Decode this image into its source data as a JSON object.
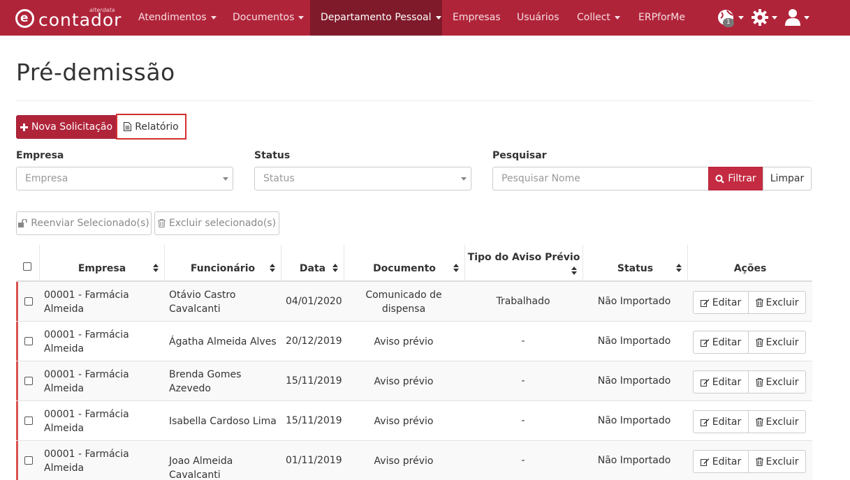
{
  "brand": {
    "tagline": "alterdata",
    "name": "contador",
    "logo_letter": "e"
  },
  "nav": {
    "items": [
      {
        "label": "Atendimentos",
        "dropdown": true
      },
      {
        "label": "Documentos",
        "dropdown": true
      },
      {
        "label": "Departamento Pessoal",
        "dropdown": true,
        "active": true
      },
      {
        "label": "Empresas",
        "dropdown": false
      },
      {
        "label": "Usuários",
        "dropdown": false
      },
      {
        "label": "Collect",
        "dropdown": true
      },
      {
        "label": "ERPforMe",
        "dropdown": false
      }
    ],
    "globe_badge": "1",
    "icons": [
      "globe-icon",
      "gear-icon",
      "user-icon"
    ]
  },
  "page": {
    "title": "Pré-demissão"
  },
  "actions": {
    "new_request": "Nova Solicitação",
    "report": "Relatório"
  },
  "filters": {
    "empresa_label": "Empresa",
    "empresa_placeholder": "Empresa",
    "status_label": "Status",
    "status_placeholder": "Status",
    "search_label": "Pesquisar",
    "search_placeholder": "Pesquisar Nome",
    "filter_button": "Filtrar",
    "clear_button": "Limpar"
  },
  "bulk": {
    "resend": "Reenviar Selecionado(s)",
    "delete": "Excluir selecionado(s)"
  },
  "table": {
    "headers": [
      "Empresa",
      "Funcionário",
      "Data",
      "Documento",
      "Tipo do Aviso Prévio",
      "Status",
      "Ações"
    ],
    "edit_label": "Editar",
    "delete_label": "Excluir",
    "rows": [
      {
        "empresa": [
          "00001 - Farmácia",
          "Almeida"
        ],
        "funcionario": [
          "Otávio Castro",
          "Cavalcanti"
        ],
        "data": "04/01/2020",
        "documento": [
          "Comunicado de",
          "dispensa"
        ],
        "tipo": "Trabalhado",
        "status": "Não Importado"
      },
      {
        "empresa": [
          "00001 - Farmácia",
          "Almeida"
        ],
        "funcionario": [
          "Ágatha Almeida Alves"
        ],
        "data": "20/12/2019",
        "documento": [
          "Aviso prévio"
        ],
        "tipo": "-",
        "status": "Não Importado"
      },
      {
        "empresa": [
          "00001 - Farmácia",
          "Almeida"
        ],
        "funcionario": [
          "Brenda Gomes",
          "Azevedo"
        ],
        "data": "15/11/2019",
        "documento": [
          "Aviso prévio"
        ],
        "tipo": "-",
        "status": "Não Importado"
      },
      {
        "empresa": [
          "00001 - Farmácia",
          "Almeida"
        ],
        "funcionario": [
          "Isabella Cardoso Lima"
        ],
        "data": "15/11/2019",
        "documento": [
          "Aviso prévio"
        ],
        "tipo": "-",
        "status": "Não Importado"
      },
      {
        "empresa": [
          "00001 - Farmácia",
          "Almeida"
        ],
        "funcionario": [
          "Joao Almeida Cavalcanti"
        ],
        "data": "01/11/2019",
        "documento": [
          "Aviso prévio"
        ],
        "tipo": "-",
        "status": "Não Importado"
      }
    ]
  },
  "colors": {
    "brand_red": "#b0243a",
    "active_nav": "#7f1a2a",
    "row_marker": "#d9534f"
  }
}
